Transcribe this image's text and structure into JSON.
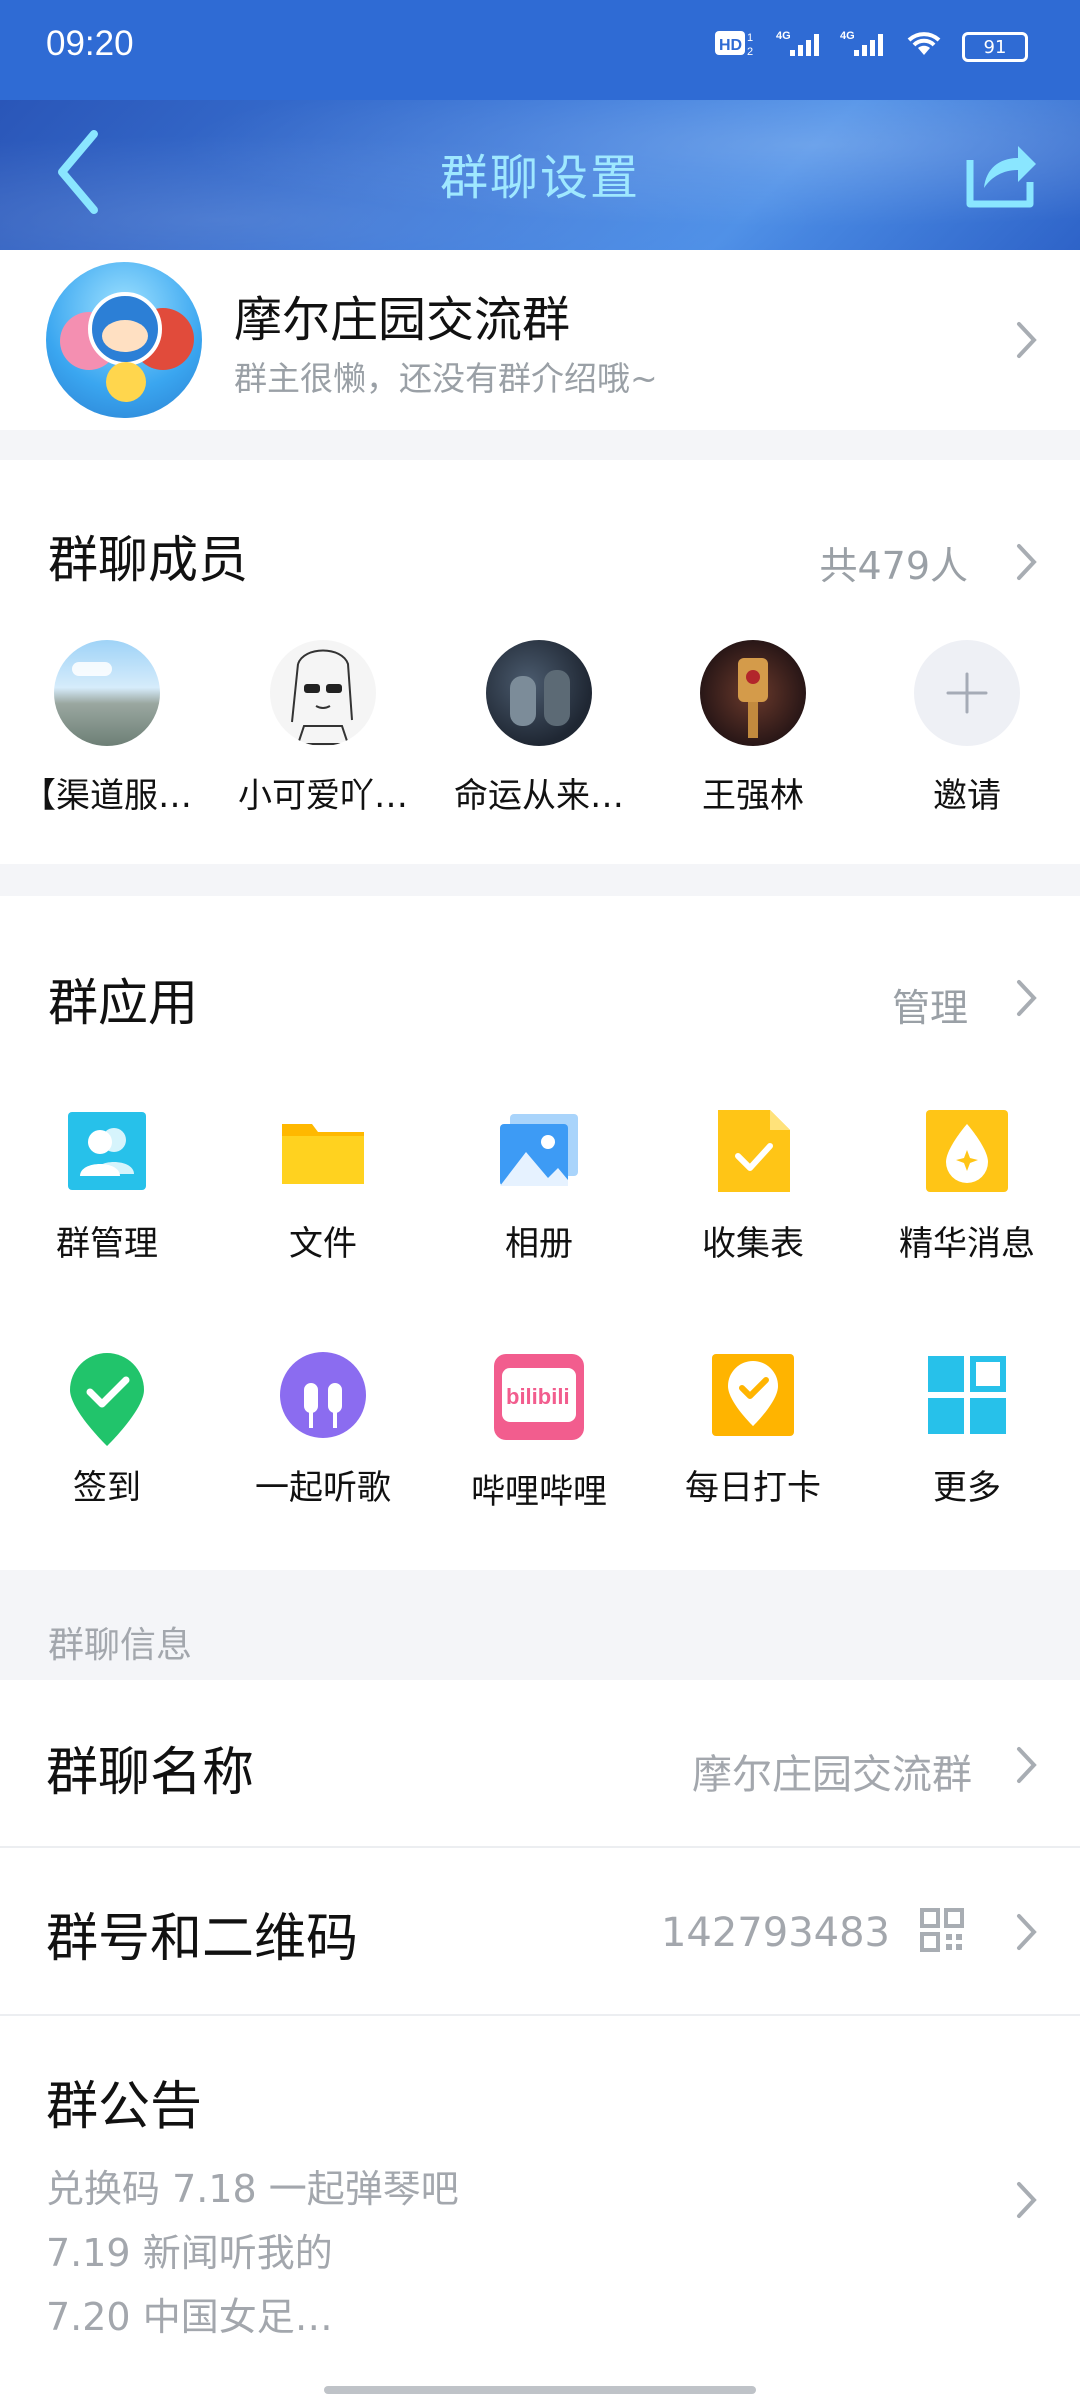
{
  "status_bar": {
    "time": "09:20",
    "battery": "91",
    "icons": [
      "hd-icon",
      "signal-4g-icon",
      "signal-4g-icon",
      "wifi-icon",
      "battery-icon"
    ]
  },
  "header": {
    "title": "群聊设置",
    "back_icon": "chevron-left-icon",
    "share_icon": "share-icon"
  },
  "group": {
    "name": "摩尔庄园交流群",
    "description": "群主很懒，还没有群介绍哦~"
  },
  "members": {
    "title": "群聊成员",
    "count": "共479人",
    "list": [
      {
        "name": "【渠道服…"
      },
      {
        "name": "小可爱吖…"
      },
      {
        "name": "命运从来…"
      },
      {
        "name": "王强林"
      },
      {
        "name": "邀请"
      }
    ]
  },
  "apps": {
    "title": "群应用",
    "manage": "管理",
    "items": [
      {
        "label": "群管理",
        "icon": "group-manage-icon",
        "color": "#27c1ea"
      },
      {
        "label": "文件",
        "icon": "folder-icon",
        "color": "#ffc516"
      },
      {
        "label": "相册",
        "icon": "album-icon",
        "color": "#3d9bf5"
      },
      {
        "label": "收集表",
        "icon": "form-icon",
        "color": "#ffc516"
      },
      {
        "label": "精华消息",
        "icon": "essence-icon",
        "color": "#ffc516"
      },
      {
        "label": "签到",
        "icon": "checkin-icon",
        "color": "#21c46b"
      },
      {
        "label": "一起听歌",
        "icon": "headphones-icon",
        "color": "#8b6cf0"
      },
      {
        "label": "哔哩哔哩",
        "icon": "bilibili-icon",
        "color": "#f25d8e"
      },
      {
        "label": "每日打卡",
        "icon": "daily-punch-icon",
        "color": "#ffb400"
      },
      {
        "label": "更多",
        "icon": "more-grid-icon",
        "color": "#27c1ea"
      }
    ]
  },
  "info": {
    "section_label": "群聊信息",
    "name_row": {
      "title": "群聊名称",
      "value": "摩尔庄园交流群"
    },
    "number_row": {
      "title": "群号和二维码",
      "value": "142793483"
    },
    "notice": {
      "title": "群公告",
      "lines": [
        "兑换码 7.18 一起弹琴吧",
        "7.19 新闻听我的",
        "7.20 中国女足…"
      ]
    }
  }
}
